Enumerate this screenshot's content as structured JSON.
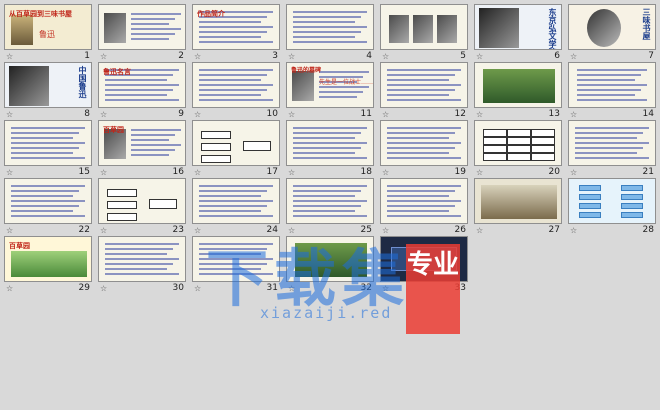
{
  "slides": [
    {
      "number": "1",
      "title": "从百草园到三味书屋",
      "subtitle": "鲁迅",
      "kind": "title"
    },
    {
      "number": "2",
      "kind": "photo-text"
    },
    {
      "number": "3",
      "title": "作品简介",
      "kind": "text"
    },
    {
      "number": "4",
      "kind": "text"
    },
    {
      "number": "5",
      "kind": "photos"
    },
    {
      "number": "6",
      "title": "东京弘文学院毕业照",
      "kind": "portrait"
    },
    {
      "number": "7",
      "title": "三味书屋",
      "kind": "oval-portrait"
    },
    {
      "number": "8",
      "title": "中国鲁迅",
      "kind": "portrait"
    },
    {
      "number": "9",
      "title": "鲁迅名言",
      "kind": "text"
    },
    {
      "number": "10",
      "kind": "text"
    },
    {
      "number": "11",
      "title": "鲁迅的墓碑",
      "subtitle": "先生是一位战士……",
      "kind": "photo-text"
    },
    {
      "number": "12",
      "kind": "text"
    },
    {
      "number": "13",
      "kind": "photo"
    },
    {
      "number": "14",
      "kind": "words"
    },
    {
      "number": "15",
      "kind": "text"
    },
    {
      "number": "16",
      "title": "百草园",
      "kind": "photo-text"
    },
    {
      "number": "17",
      "kind": "diagram"
    },
    {
      "number": "18",
      "kind": "text"
    },
    {
      "number": "19",
      "kind": "text"
    },
    {
      "number": "20",
      "kind": "table"
    },
    {
      "number": "21",
      "kind": "text"
    },
    {
      "number": "22",
      "kind": "text"
    },
    {
      "number": "23",
      "kind": "diagram"
    },
    {
      "number": "24",
      "kind": "text"
    },
    {
      "number": "25",
      "kind": "text"
    },
    {
      "number": "26",
      "kind": "text"
    },
    {
      "number": "27",
      "kind": "painting"
    },
    {
      "number": "28",
      "kind": "arrows"
    },
    {
      "number": "29",
      "title": "百草园",
      "kind": "cartoon"
    },
    {
      "number": "30",
      "kind": "text"
    },
    {
      "number": "31",
      "kind": "text"
    },
    {
      "number": "32",
      "kind": "photo"
    },
    {
      "number": "33",
      "kind": "dark"
    }
  ],
  "watermark": {
    "main": "下载集",
    "pro": "专业",
    "url": "xiazaiji.red"
  }
}
